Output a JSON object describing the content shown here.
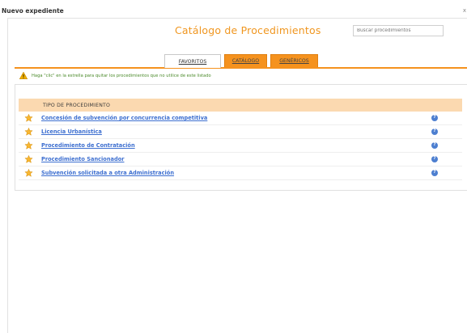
{
  "window": {
    "title": "Nuevo expediente",
    "close_glyph": "x"
  },
  "header": {
    "title": "Catálogo de Procedimientos"
  },
  "search": {
    "placeholder": "Buscar procedimientos"
  },
  "tabs": [
    {
      "label": "FAVORITOS",
      "active": true
    },
    {
      "label": "CATÁLOGO",
      "active": false
    },
    {
      "label": "GENÉRICOS",
      "active": false
    }
  ],
  "notice": {
    "text": "Haga \"clic\" en la estrella para quitar los procedimientos que no utilice de este listado",
    "icon": "warning-icon"
  },
  "table": {
    "header": "TIPO DE PROCEDIMIENTO",
    "rows": [
      {
        "label": "Concesión de subvención por concurrencia competitiva"
      },
      {
        "label": "Licencia Urbanística"
      },
      {
        "label": "Procedimiento de Contratación"
      },
      {
        "label": "Procedimiento Sancionador"
      },
      {
        "label": "Subvención solicitada a otra Administración"
      }
    ]
  },
  "colors": {
    "accent": "#f5921e",
    "link": "#3d6fd0",
    "header_bg": "#fbd9b0",
    "notice_text": "#4a8a2a"
  }
}
